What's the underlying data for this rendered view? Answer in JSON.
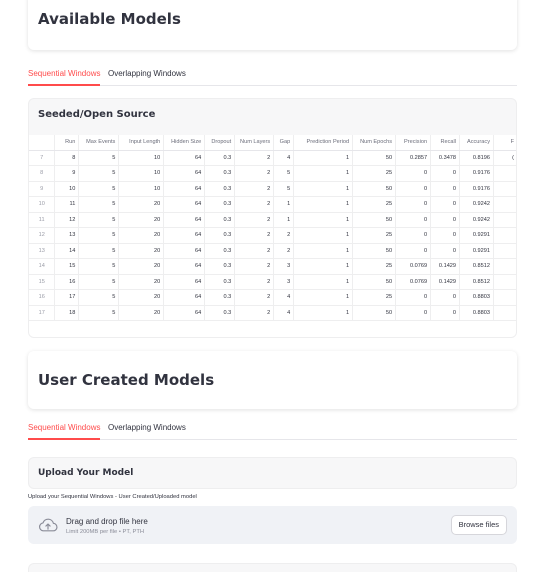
{
  "available": {
    "title": "Available Models"
  },
  "tabs1": {
    "items": [
      "Sequential Windows",
      "Overlapping Windows"
    ],
    "active": 0
  },
  "seeded": {
    "title": "Seeded/Open Source",
    "columns": [
      "",
      "Run",
      "Max Events",
      "Input Length",
      "Hidden Size",
      "Dropout",
      "Num Layers",
      "Gap",
      "Prediction Period",
      "Num Epochs",
      "Precision",
      "Recall",
      "Accuracy",
      "F"
    ],
    "rows": [
      [
        "7",
        "8",
        "5",
        "10",
        "64",
        "0.3",
        "2",
        "4",
        "1",
        "50",
        "0.2857",
        "0.3478",
        "0.8196",
        "("
      ],
      [
        "8",
        "9",
        "5",
        "10",
        "64",
        "0.3",
        "2",
        "5",
        "1",
        "25",
        "0",
        "0",
        "0.9176",
        ""
      ],
      [
        "9",
        "10",
        "5",
        "10",
        "64",
        "0.3",
        "2",
        "5",
        "1",
        "50",
        "0",
        "0",
        "0.9176",
        ""
      ],
      [
        "10",
        "11",
        "5",
        "20",
        "64",
        "0.3",
        "2",
        "1",
        "1",
        "25",
        "0",
        "0",
        "0.9242",
        ""
      ],
      [
        "11",
        "12",
        "5",
        "20",
        "64",
        "0.3",
        "2",
        "1",
        "1",
        "50",
        "0",
        "0",
        "0.9242",
        ""
      ],
      [
        "12",
        "13",
        "5",
        "20",
        "64",
        "0.3",
        "2",
        "2",
        "1",
        "25",
        "0",
        "0",
        "0.9291",
        ""
      ],
      [
        "13",
        "14",
        "5",
        "20",
        "64",
        "0.3",
        "2",
        "2",
        "1",
        "50",
        "0",
        "0",
        "0.9291",
        ""
      ],
      [
        "14",
        "15",
        "5",
        "20",
        "64",
        "0.3",
        "2",
        "3",
        "1",
        "25",
        "0.0769",
        "0.1429",
        "0.8512",
        ""
      ],
      [
        "15",
        "16",
        "5",
        "20",
        "64",
        "0.3",
        "2",
        "3",
        "1",
        "50",
        "0.0769",
        "0.1429",
        "0.8512",
        ""
      ],
      [
        "16",
        "17",
        "5",
        "20",
        "64",
        "0.3",
        "2",
        "4",
        "1",
        "25",
        "0",
        "0",
        "0.8803",
        ""
      ],
      [
        "17",
        "18",
        "5",
        "20",
        "64",
        "0.3",
        "2",
        "4",
        "1",
        "50",
        "0",
        "0",
        "0.8803",
        ""
      ]
    ]
  },
  "user": {
    "title": "User Created Models"
  },
  "tabs2": {
    "items": [
      "Sequential Windows",
      "Overlapping Windows"
    ],
    "active": 0
  },
  "upload": {
    "title": "Upload Your Model",
    "caption": "Upload your Sequential Windows - User Created/Uploaded model",
    "drop_title": "Drag and drop file here",
    "drop_sub": "Limit 200MB per file • PT, PTH",
    "browse_label": "Browse files",
    "icon": "cloud-upload-icon"
  },
  "colors": {
    "accent": "#ff4b4b",
    "text": "#31333f",
    "muted": "#8a8c98",
    "dropzone": "#f0f2f6"
  }
}
